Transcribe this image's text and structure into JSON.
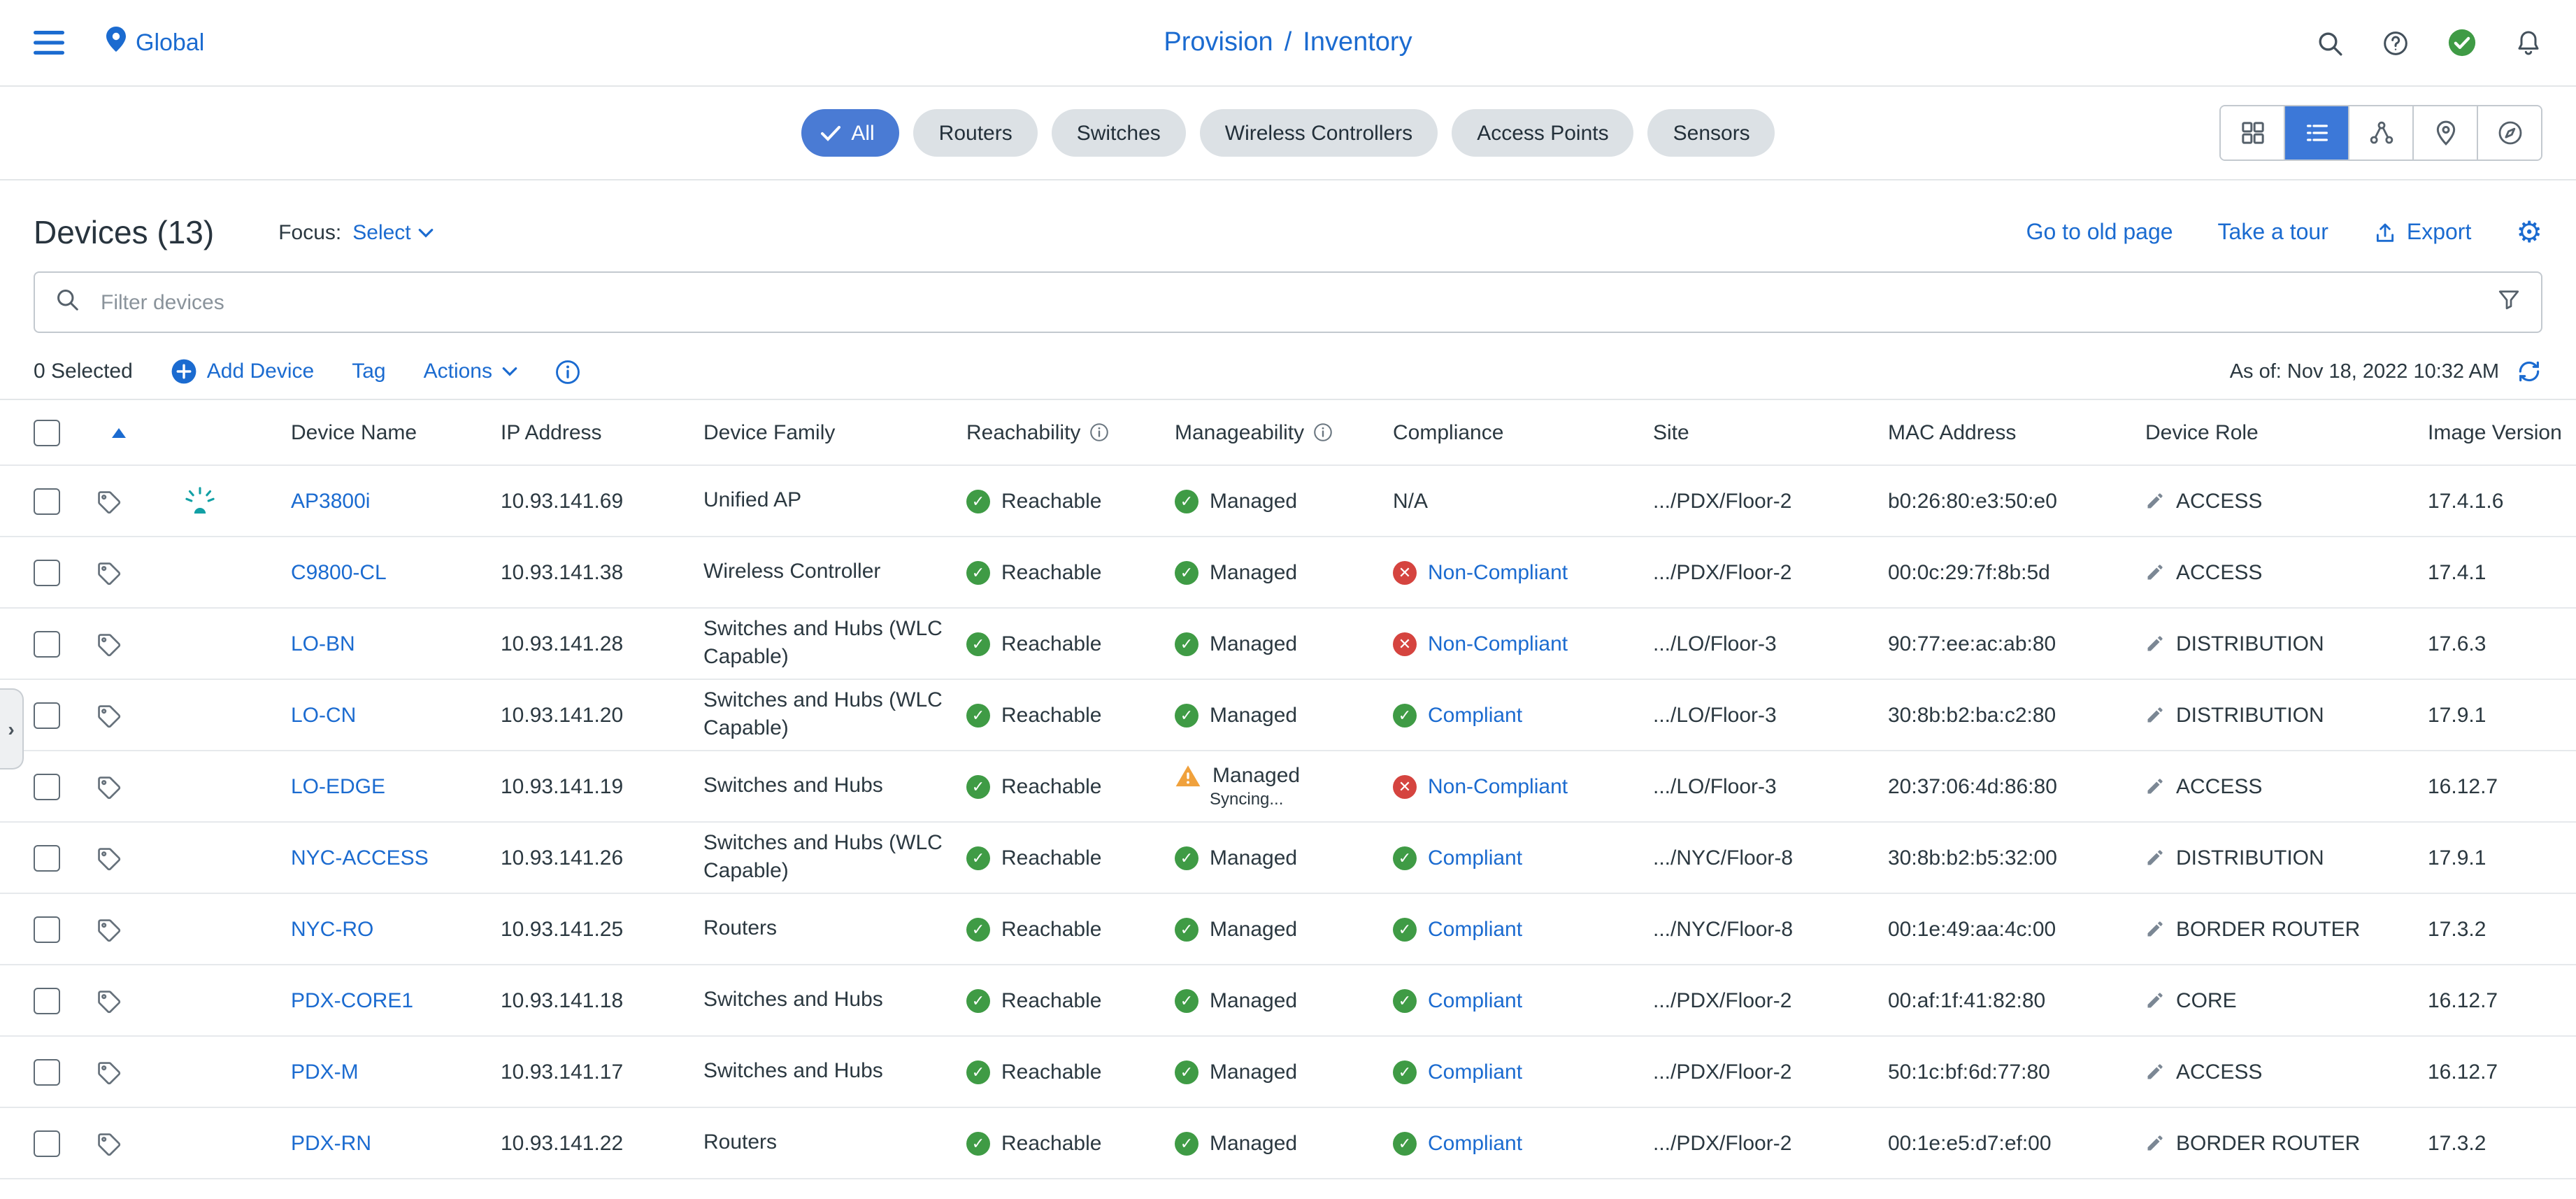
{
  "colors": {
    "link_blue": "#1b6bd0",
    "chip_selected_blue": "#4a7bd4",
    "success_green": "#3f9b45",
    "error_red": "#d5443f",
    "warning_orange": "#f0a13c",
    "device_teal": "#12a0a5",
    "text_dark": "#2b3840",
    "border_gray": "#e3e6e8"
  },
  "icons": {
    "hamburger": "menu-bars",
    "global": "location-pin",
    "search": "magnifier",
    "help": "question-circle",
    "health": "check-circle-green",
    "notifications": "bell",
    "view_card": "grid",
    "view_list": "list-lines",
    "view_topology": "hierarchy",
    "view_map": "map-pin",
    "view_compass": "compass",
    "export": "arrow-up-tray",
    "settings": "gear",
    "filter": "funnel",
    "add": "plus-circle",
    "info": "info-circle",
    "refresh": "sync-arrows",
    "tag": "tag-outline",
    "ap_device": "beacon",
    "edit_role": "pencil",
    "status_ok": "check-circle",
    "status_error": "x-circle",
    "status_warning": "warning-triangle"
  },
  "topbar": {
    "global": "Global",
    "breadcrumb": {
      "section": "Provision",
      "separator": "/",
      "page": "Inventory"
    }
  },
  "chips": [
    {
      "label": "All",
      "selected": true
    },
    {
      "label": "Routers",
      "selected": false
    },
    {
      "label": "Switches",
      "selected": false
    },
    {
      "label": "Wireless Controllers",
      "selected": false
    },
    {
      "label": "Access Points",
      "selected": false
    },
    {
      "label": "Sensors",
      "selected": false
    }
  ],
  "page": {
    "title": "Devices (13)",
    "focus_label": "Focus:",
    "focus_value": "Select",
    "links": {
      "old_page": "Go to old page",
      "tour": "Take a tour",
      "export": "Export"
    }
  },
  "search": {
    "placeholder": "Filter devices"
  },
  "actions": {
    "selected": "0 Selected",
    "add_device": "Add Device",
    "tag": "Tag",
    "actions": "Actions",
    "as_of": "As of: Nov 18, 2022 10:32 AM"
  },
  "table": {
    "columns": {
      "device_name": "Device Name",
      "ip": "IP Address",
      "family": "Device Family",
      "reachability": "Reachability",
      "manageability": "Manageability",
      "compliance": "Compliance",
      "site": "Site",
      "mac": "MAC Address",
      "role": "Device Role",
      "image": "Image Version"
    },
    "rows": [
      {
        "name": "AP3800i",
        "ip": "10.93.141.69",
        "family": "Unified AP",
        "reachability": "Reachable",
        "manageability": "Managed",
        "manageability_status": "ok",
        "compliance": "N/A",
        "compliance_status": "na",
        "site": ".../PDX/Floor-2",
        "mac": "b0:26:80:e3:50:e0",
        "role": "ACCESS",
        "image": "17.4.1.6",
        "device_icon": true
      },
      {
        "name": "C9800-CL",
        "ip": "10.93.141.38",
        "family": "Wireless Controller",
        "reachability": "Reachable",
        "manageability": "Managed",
        "manageability_status": "ok",
        "compliance": "Non-Compliant",
        "compliance_status": "error",
        "site": ".../PDX/Floor-2",
        "mac": "00:0c:29:7f:8b:5d",
        "role": "ACCESS",
        "image": "17.4.1",
        "device_icon": false
      },
      {
        "name": "LO-BN",
        "ip": "10.93.141.28",
        "family": "Switches and Hubs (WLC Capable)",
        "reachability": "Reachable",
        "manageability": "Managed",
        "manageability_status": "ok",
        "compliance": "Non-Compliant",
        "compliance_status": "error",
        "site": ".../LO/Floor-3",
        "mac": "90:77:ee:ac:ab:80",
        "role": "DISTRIBUTION",
        "image": "17.6.3",
        "device_icon": false
      },
      {
        "name": "LO-CN",
        "ip": "10.93.141.20",
        "family": "Switches and Hubs (WLC Capable)",
        "reachability": "Reachable",
        "manageability": "Managed",
        "manageability_status": "ok",
        "compliance": "Compliant",
        "compliance_status": "ok",
        "site": ".../LO/Floor-3",
        "mac": "30:8b:b2:ba:c2:80",
        "role": "DISTRIBUTION",
        "image": "17.9.1",
        "device_icon": false
      },
      {
        "name": "LO-EDGE",
        "ip": "10.93.141.19",
        "family": "Switches and Hubs",
        "reachability": "Reachable",
        "manageability": "Managed",
        "manageability_sub": "Syncing...",
        "manageability_status": "warning",
        "compliance": "Non-Compliant",
        "compliance_status": "error",
        "site": ".../LO/Floor-3",
        "mac": "20:37:06:4d:86:80",
        "role": "ACCESS",
        "image": "16.12.7",
        "device_icon": false
      },
      {
        "name": "NYC-ACCESS",
        "ip": "10.93.141.26",
        "family": "Switches and Hubs (WLC Capable)",
        "reachability": "Reachable",
        "manageability": "Managed",
        "manageability_status": "ok",
        "compliance": "Compliant",
        "compliance_status": "ok",
        "site": ".../NYC/Floor-8",
        "mac": "30:8b:b2:b5:32:00",
        "role": "DISTRIBUTION",
        "image": "17.9.1",
        "device_icon": false
      },
      {
        "name": "NYC-RO",
        "ip": "10.93.141.25",
        "family": "Routers",
        "reachability": "Reachable",
        "manageability": "Managed",
        "manageability_status": "ok",
        "compliance": "Compliant",
        "compliance_status": "ok",
        "site": ".../NYC/Floor-8",
        "mac": "00:1e:49:aa:4c:00",
        "role": "BORDER ROUTER",
        "image": "17.3.2",
        "device_icon": false
      },
      {
        "name": "PDX-CORE1",
        "ip": "10.93.141.18",
        "family": "Switches and Hubs",
        "reachability": "Reachable",
        "manageability": "Managed",
        "manageability_status": "ok",
        "compliance": "Compliant",
        "compliance_status": "ok",
        "site": ".../PDX/Floor-2",
        "mac": "00:af:1f:41:82:80",
        "role": "CORE",
        "image": "16.12.7",
        "device_icon": false
      },
      {
        "name": "PDX-M",
        "ip": "10.93.141.17",
        "family": "Switches and Hubs",
        "reachability": "Reachable",
        "manageability": "Managed",
        "manageability_status": "ok",
        "compliance": "Compliant",
        "compliance_status": "ok",
        "site": ".../PDX/Floor-2",
        "mac": "50:1c:bf:6d:77:80",
        "role": "ACCESS",
        "image": "16.12.7",
        "device_icon": false
      },
      {
        "name": "PDX-RN",
        "ip": "10.93.141.22",
        "family": "Routers",
        "reachability": "Reachable",
        "manageability": "Managed",
        "manageability_status": "ok",
        "compliance": "Compliant",
        "compliance_status": "ok",
        "site": ".../PDX/Floor-2",
        "mac": "00:1e:e5:d7:ef:00",
        "role": "BORDER ROUTER",
        "image": "17.3.2",
        "device_icon": false
      }
    ]
  }
}
